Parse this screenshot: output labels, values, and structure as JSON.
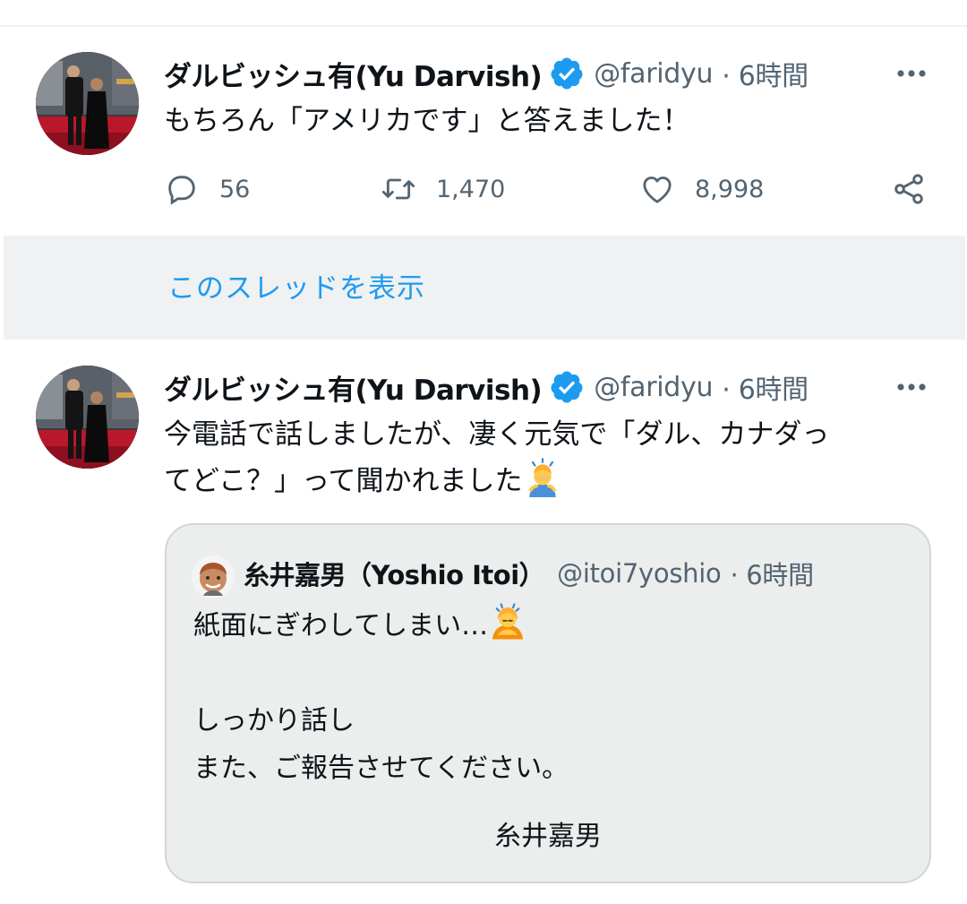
{
  "tweets": [
    {
      "author_name": "ダルビッシュ有(Yu Darvish)",
      "handle": "@faridyu",
      "time": "· 6時間",
      "text": "もちろん「アメリカです」と答えました！",
      "actions": {
        "replies": "56",
        "retweets": "1,470",
        "likes": "8,998"
      }
    },
    {
      "author_name": "ダルビッシュ有(Yu Darvish)",
      "handle": "@faridyu",
      "time": "· 6時間",
      "text_line1": "今電話で話しましたが、凄く元気で「ダル、カナダっ",
      "text_line2": "てどこ？」って聞かれました"
    }
  ],
  "thread_link": "このスレッドを表示",
  "quote": {
    "author_name": "糸井嘉男（Yoshio Itoi）",
    "handle": "@itoi7yoshio",
    "time": "· 6時間",
    "line1": "紙面にぎわしてしまい…",
    "line2": "しっかり話し",
    "line3": "また、ご報告させてください。",
    "signature": "糸井嘉男"
  },
  "icons": [
    "verified-badge-icon",
    "more-icon",
    "reply-icon",
    "retweet-icon",
    "like-icon",
    "share-icon",
    "facepalm-man-emoji",
    "bowing-woman-emoji"
  ],
  "colors": {
    "accent": "#1d9bf0",
    "secondary_text": "#536471",
    "thread_bar": "#eff1f2"
  }
}
